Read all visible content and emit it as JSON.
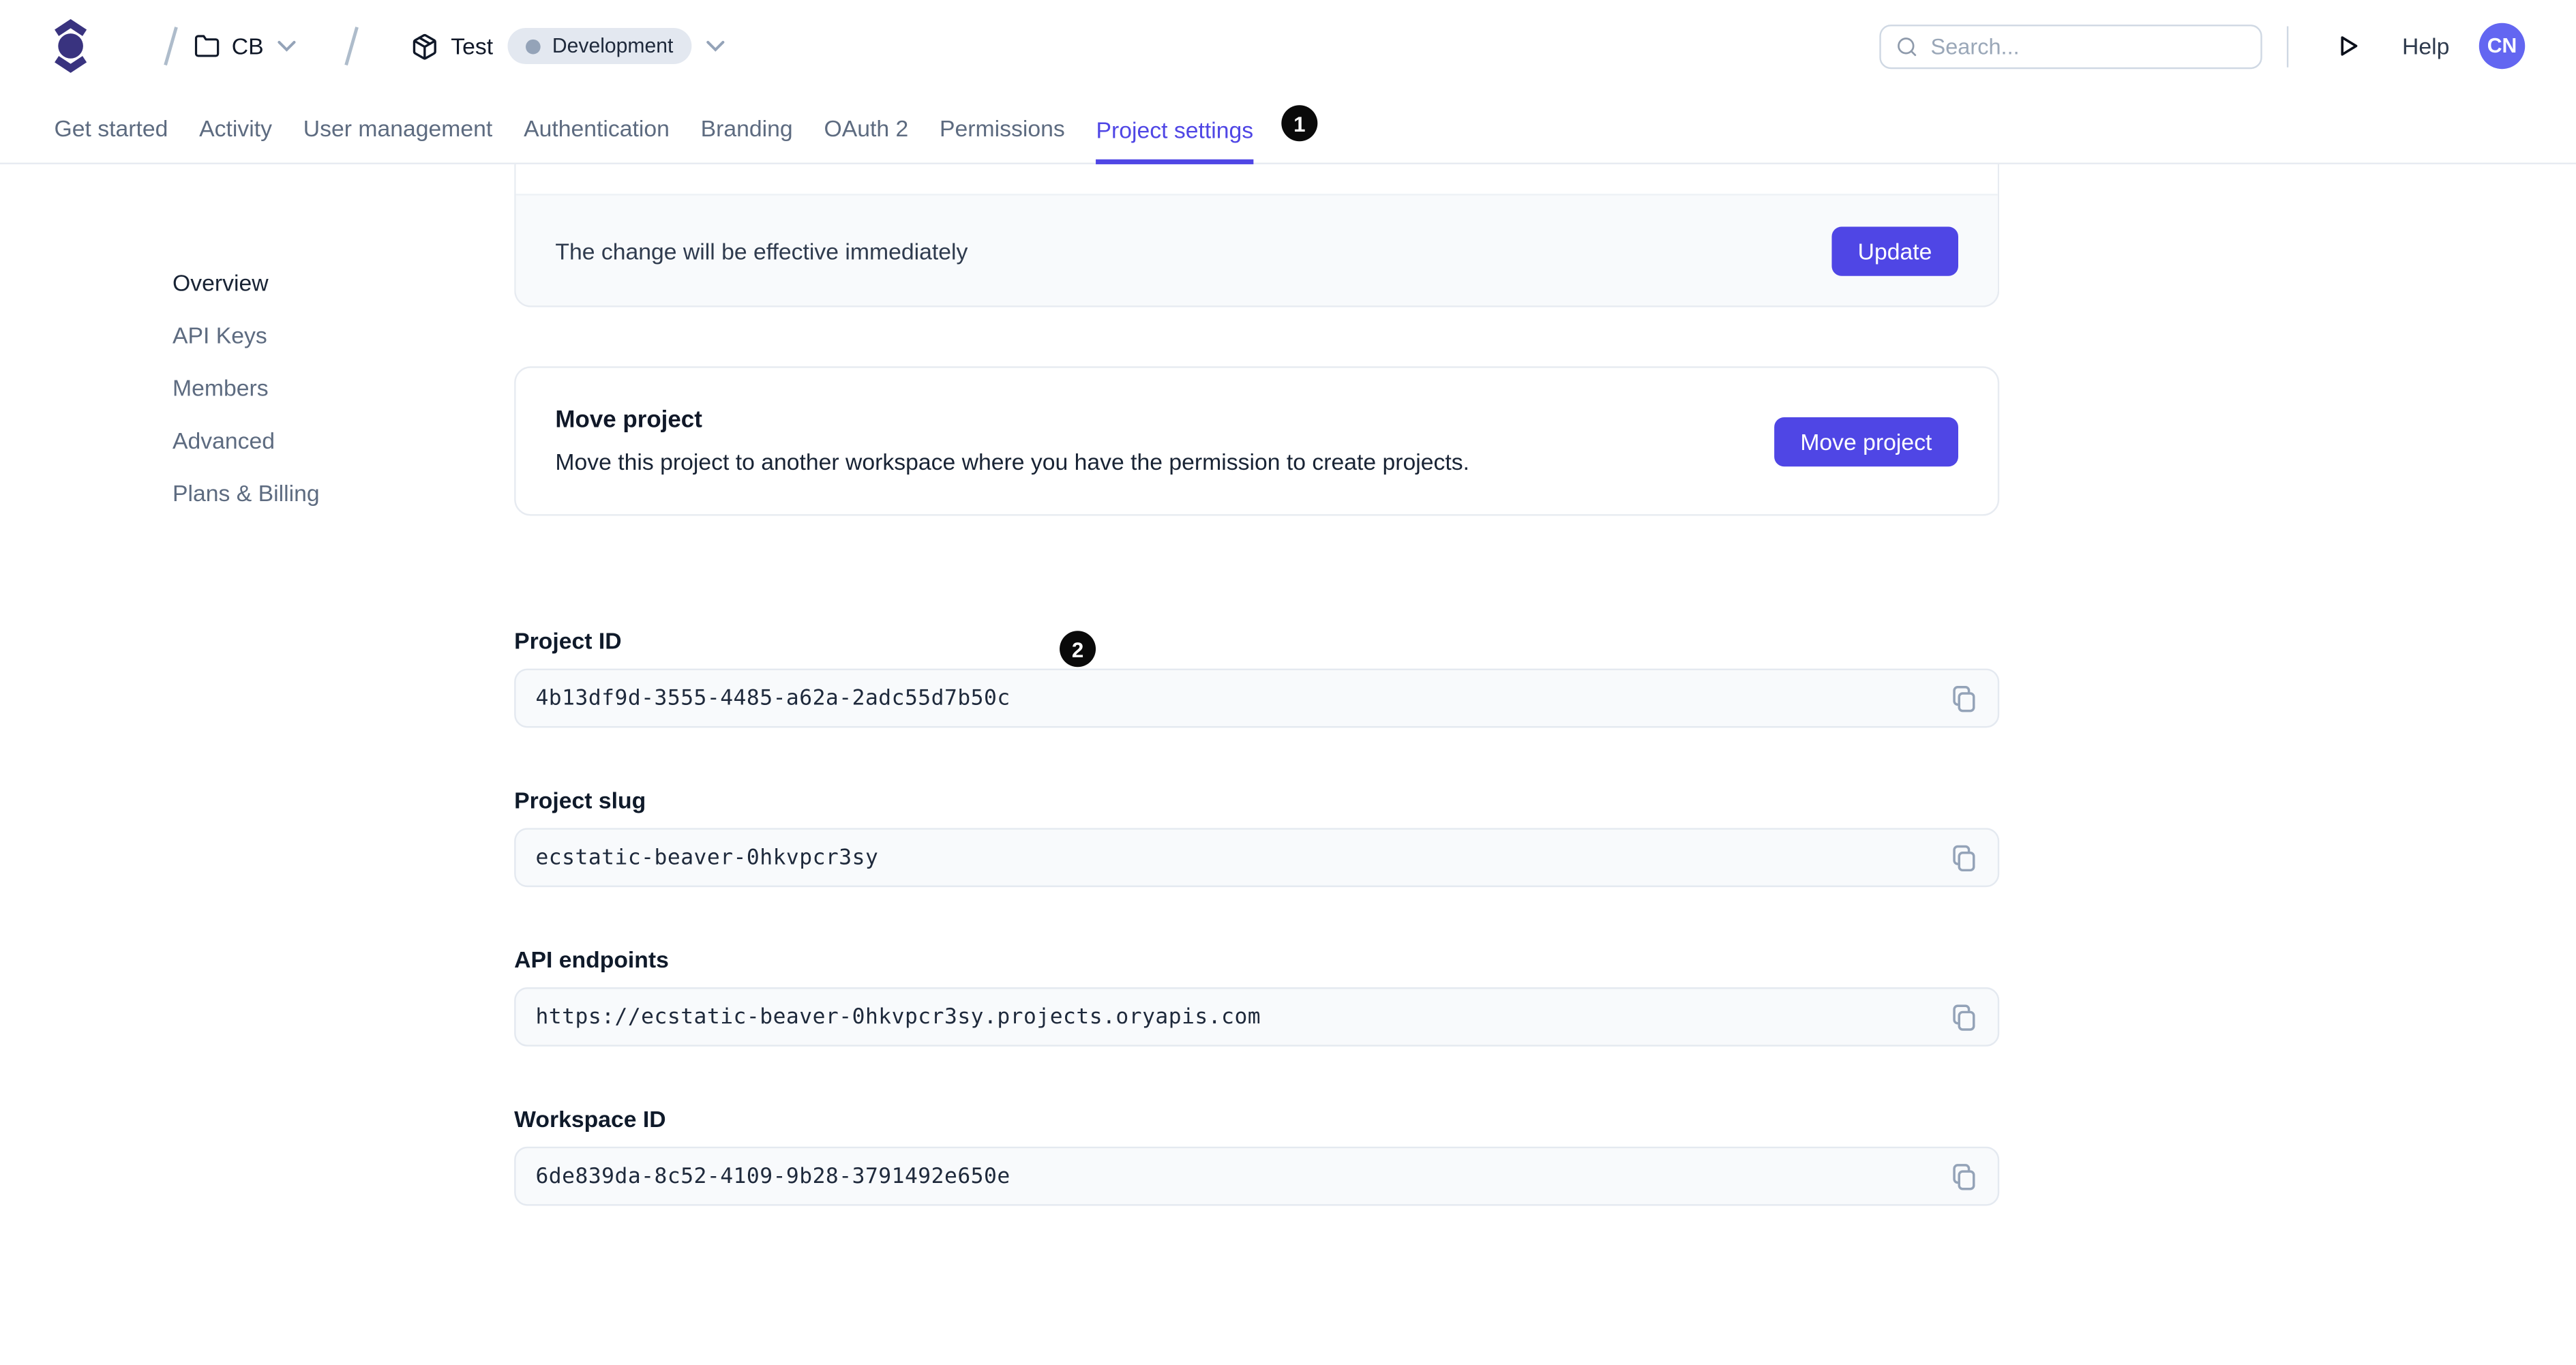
{
  "header": {
    "breadcrumb": {
      "workspace": "CB",
      "project": "Test",
      "environment": "Development"
    },
    "search": {
      "placeholder": "Search..."
    },
    "help_label": "Help",
    "avatar_initials": "CN"
  },
  "tabs": [
    {
      "label": "Get started"
    },
    {
      "label": "Activity"
    },
    {
      "label": "User management"
    },
    {
      "label": "Authentication"
    },
    {
      "label": "Branding"
    },
    {
      "label": "OAuth 2"
    },
    {
      "label": "Permissions"
    },
    {
      "label": "Project settings",
      "active": true
    }
  ],
  "annotations": {
    "marker1": "1",
    "marker2": "2"
  },
  "sidebar": [
    "Overview",
    "API Keys",
    "Members",
    "Advanced",
    "Plans & Billing"
  ],
  "cards": {
    "update": {
      "note": "The change will be effective immediately",
      "button": "Update"
    },
    "move": {
      "title": "Move project",
      "description": "Move this project to another workspace where you have the permission to create projects.",
      "button": "Move project"
    }
  },
  "fields": [
    {
      "label": "Project ID",
      "value": "4b13df9d-3555-4485-a62a-2adc55d7b50c"
    },
    {
      "label": "Project slug",
      "value": "ecstatic-beaver-0hkvpcr3sy"
    },
    {
      "label": "API endpoints",
      "value": "https://ecstatic-beaver-0hkvpcr3sy.projects.oryapis.com"
    },
    {
      "label": "Workspace ID",
      "value": "6de839da-8c52-4109-9b28-3791492e650e"
    }
  ],
  "colors": {
    "accent": "#4f46e5",
    "logo": "#39337f",
    "avatar": "#6366f1",
    "tab_inactive": "#5d6b80",
    "field_bg": "#f8fafc",
    "border": "#e7ebf1",
    "badge_bg": "#e3e8f0",
    "muted_icon": "#94a3b8",
    "marker_bg": "#0a0a0a"
  }
}
